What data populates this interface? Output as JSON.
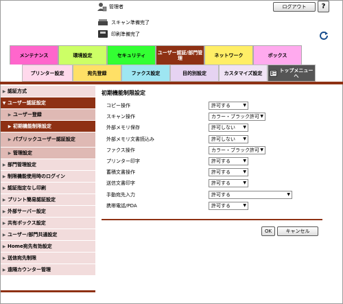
{
  "header": {
    "admin_label": "管理者",
    "logout_label": "ログアウト",
    "help_label": "?",
    "status": [
      {
        "icon": "scanner-icon",
        "label": "スキャン準備完了"
      },
      {
        "icon": "printer-icon",
        "label": "印刷準備完了"
      }
    ]
  },
  "main_tabs": [
    {
      "label": "メンテナンス",
      "color": "#ff66cc"
    },
    {
      "label": "環境設定",
      "color": "#ccff66"
    },
    {
      "label": "セキュリティ",
      "color": "#33ff33"
    },
    {
      "label": "ユーザー認証/部門管理",
      "color": "#8e3114",
      "active": true
    },
    {
      "label": "ネットワーク",
      "color": "#ffee66"
    },
    {
      "label": "ボックス",
      "color": "#ffaaee"
    }
  ],
  "sub_tabs": [
    {
      "label": "プリンター設定",
      "color": "#ffd9ec"
    },
    {
      "label": "宛先登録",
      "color": "#ffe066"
    },
    {
      "label": "ファクス設定",
      "color": "#9ee6f2"
    },
    {
      "label": "目的別設定",
      "color": "#e6d3f2"
    },
    {
      "label": "カスタマイズ設定",
      "color": "#f0e3f5"
    },
    {
      "label": "トップメニューへ",
      "color": "#555555",
      "active": true
    }
  ],
  "sidebar": {
    "items": [
      {
        "label": "認証方式",
        "type": "main"
      },
      {
        "label": "ユーザー認証設定",
        "type": "open"
      },
      {
        "label": "ユーザー登録",
        "type": "sub"
      },
      {
        "label": "初期機能制限設定",
        "type": "sub-active"
      },
      {
        "label": "パブリックユーザー認証設定",
        "type": "sub-tall"
      },
      {
        "label": "管理設定",
        "type": "sub"
      },
      {
        "label": "部門管理設定",
        "type": "main"
      },
      {
        "label": "制限機能使用時のログイン",
        "type": "main"
      },
      {
        "label": "認証指定なし印刷",
        "type": "main"
      },
      {
        "label": "プリント簡易認証設定",
        "type": "main"
      },
      {
        "label": "外部サーバー設定",
        "type": "main"
      },
      {
        "label": "共有ボックス設定",
        "type": "main"
      },
      {
        "label": "ユーザー/部門共通設定",
        "type": "main"
      },
      {
        "label": "Home宛先有効設定",
        "type": "main"
      },
      {
        "label": "送信宛先制限",
        "type": "main"
      },
      {
        "label": "遠隔カウンター管理",
        "type": "main"
      }
    ]
  },
  "page_title": "初期機能制限設定",
  "form": {
    "rows": [
      {
        "label": "コピー操作",
        "value": "許可する",
        "wide": false,
        "mid": false
      },
      {
        "label": "スキャン操作",
        "value": "カラー・ブラック許可",
        "wide": false,
        "mid": true
      },
      {
        "label": "外部メモリ保存",
        "value": "許可しない",
        "wide": false,
        "mid": false
      },
      {
        "label": "外部メモリ文書読込み",
        "value": "許可しない",
        "wide": false,
        "mid": false
      },
      {
        "label": "ファクス操作",
        "value": "カラー・ブラック許可",
        "wide": false,
        "mid": true
      },
      {
        "label": "プリンター印字",
        "value": "許可する",
        "wide": false,
        "mid": false
      },
      {
        "label": "蓄積文書操作",
        "value": "許可する",
        "wide": false,
        "mid": false
      },
      {
        "label": "送信文書印字",
        "value": "許可する",
        "wide": false,
        "mid": false
      },
      {
        "label": "手動宛先入力",
        "value": "許可する",
        "wide": true,
        "mid": false
      },
      {
        "label": "携帯電話/PDA",
        "value": "許可する",
        "wide": false,
        "mid": false
      }
    ]
  },
  "buttons": {
    "ok": "OK",
    "cancel": "キャンセル"
  }
}
